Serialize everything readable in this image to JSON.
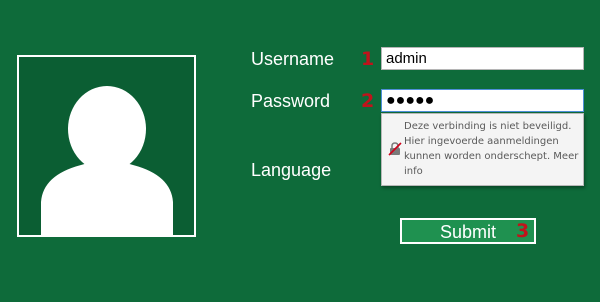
{
  "login": {
    "username_label": "Username",
    "password_label": "Password",
    "language_label": "Language",
    "username_value": "admin",
    "password_value": "●●●●●",
    "submit_label": "Submit"
  },
  "steps": {
    "username": "1",
    "password": "2",
    "submit": "3"
  },
  "security_tooltip": {
    "icon": "broken-lock-icon",
    "message": "Deze verbinding is niet beveiligd. Hier ingevoerde aanmeldingen kunnen worden onderschept. Meer info"
  },
  "colors": {
    "background": "#0e6b3a",
    "button": "#1f9150",
    "step_marker": "#c0131b"
  }
}
